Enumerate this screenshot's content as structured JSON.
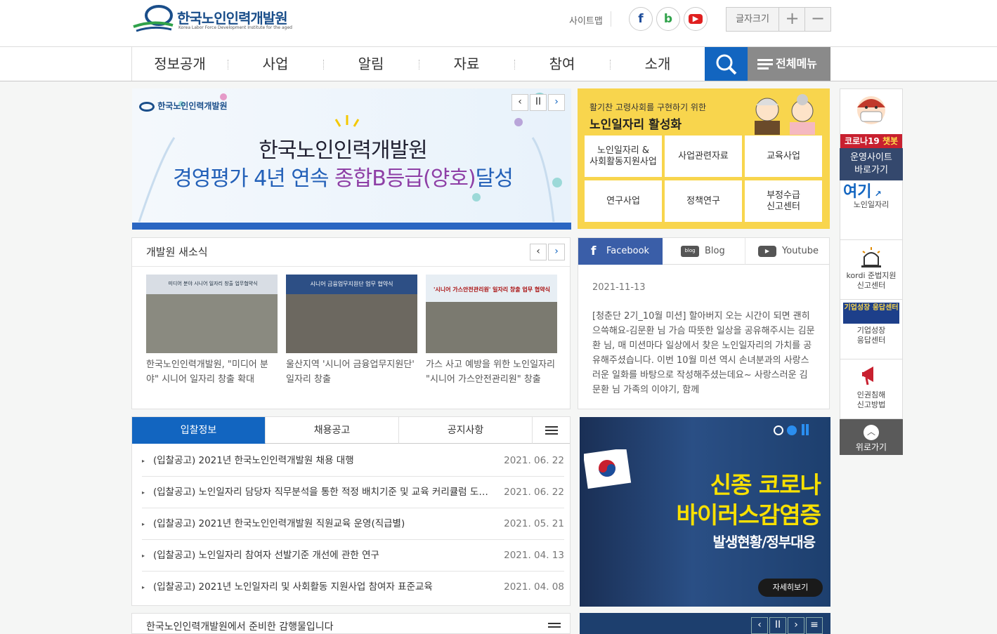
{
  "header": {
    "logo_title": "한국노인인력개발원",
    "logo_sub": "Korea Labor Force Development Institute for the aged",
    "sitemap": "사이트맵",
    "fontsize_label": "글자크기",
    "plus": "+",
    "minus": "−",
    "sns": [
      "f",
      "b",
      "▶"
    ]
  },
  "nav": {
    "items": [
      "정보공개",
      "사업",
      "알림",
      "자료",
      "참여",
      "소개"
    ],
    "all_menu": "전체메뉴"
  },
  "banner": {
    "org": "한국노인인력개발원",
    "line1": "한국노인인력개발원",
    "line2a": "경영평가 4년 연속 ",
    "line2b": "종합B등급(양호)",
    "line2c": "달성"
  },
  "jobs": {
    "sub": "활기찬 고령사회를 구현하기 위한",
    "title": "노인일자리 활성화",
    "cells": [
      [
        "노인일자리 &",
        "사회활동지원사업"
      ],
      [
        "사업관련자료"
      ],
      [
        "교육사업"
      ],
      [
        "연구사업"
      ],
      [
        "정책연구"
      ],
      [
        "부정수급",
        "신고센터"
      ]
    ]
  },
  "news": {
    "title": "개발원 새소식",
    "items": [
      {
        "img": "미디어 분야 시니어 일자리 창출 업무협약식",
        "cap": "한국노인인력개발원, \"미디어 분야\" 시니어 일자리 창출 확대"
      },
      {
        "img": "시니어 금융업무지원단 업무 협약식",
        "cap": "울산지역 '시니어 금융업무지원단' 일자리 창출"
      },
      {
        "img": "'시니어 가스안전관리원' 일자리 창출 업무 협약식",
        "cap": "가스 사고 예방을 위한 노인일자리 \"시니어 가스안전관리원\" 창출"
      }
    ]
  },
  "social": {
    "tabs": [
      "Facebook",
      "Blog",
      "Youtube"
    ],
    "date": "2021-11-13",
    "text": "[청춘단 2기_10월 미션] 할아버지 오는 시간이 되면 괜히 으쓱해요-김문환 님 가슴 따뜻한 일상을 공유해주시는 김문환 님, 매 미션마다 일상에서 찾은 노인일자리의 가치를 공유해주셨습니다. 이번 10월 미션 역시 손녀분과의 사랑스러운 일화를 바탕으로 작성해주셨는데요~ 사랑스러운 김문환 님 가족의 이야기, 함께"
  },
  "board": {
    "tabs": [
      "입찰정보",
      "채용공고",
      "공지사항"
    ],
    "rows": [
      {
        "t": "(입찰공고) 2021년 한국노인인력개발원 채용 대행",
        "d": "2021. 06. 22"
      },
      {
        "t": "(입찰공고) 노인일자리 담당자 직무분석을 통한 적정 배치기준 및 교육 커리큘럼 도출 연구",
        "d": "2021. 06. 22"
      },
      {
        "t": "(입찰공고) 2021년 한국노인인력개발원 직원교육 운영(직급별)",
        "d": "2021. 05. 21"
      },
      {
        "t": "(입찰공고) 노인일자리 참여자 선발기준 개선에 관한 연구",
        "d": "2021. 04. 13"
      },
      {
        "t": "(입찰공고) 2021년 노인일자리 및 사회활동 지원사업 참여자 표준교육",
        "d": "2021. 04. 08"
      }
    ]
  },
  "covid": {
    "line1": "신종 코로나",
    "line2": "바이러스감염증",
    "line3": "발생현황/정부대응",
    "more": "자세히보기"
  },
  "bottom": {
    "text": "한국노인인력개발원에서 준비한 감행물입니다"
  },
  "quick": {
    "chat1": "코로나19 ",
    "chat2": "챗봇",
    "op1": "운영사이트",
    "op2": "바로가기",
    "yeogi": "여기",
    "yeogi_label": "노인일자리",
    "kordi1": "kordi 준법지원",
    "kordi2": "신고센터",
    "growth_logo": "기업성장 응답센터",
    "growth1": "기업성장",
    "growth2": "응답센터",
    "human1": "인권침해",
    "human2": "신고방법",
    "top": "위로가기"
  },
  "colors": {
    "primary": "#1265c0",
    "yellow": "#f8d54d",
    "purple": "#8e3fa6",
    "navy": "#1d3f6e"
  }
}
